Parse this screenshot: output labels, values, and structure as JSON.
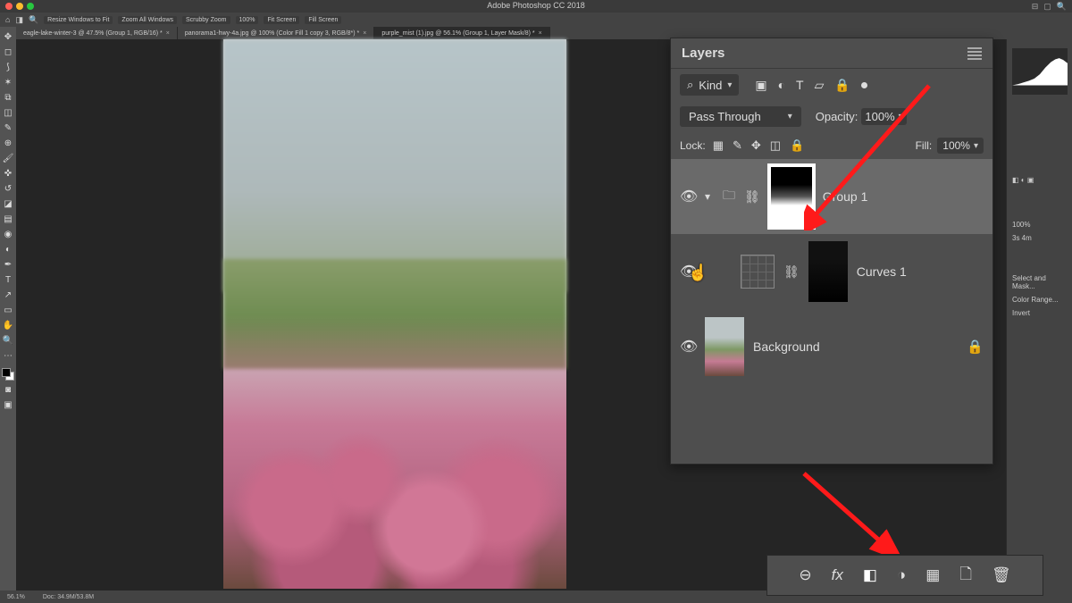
{
  "app_title": "Adobe Photoshop CC 2018",
  "window_controls": [
    "⊟",
    "▢",
    "✕"
  ],
  "options_bar": {
    "icons": [
      "⌂",
      "◨",
      "🔍"
    ],
    "buttons": [
      "Resize Windows to Fit",
      "Zoom All Windows",
      "Scrubby Zoom",
      "100%",
      "Fit Screen",
      "Fill Screen"
    ]
  },
  "doc_tabs": [
    {
      "label": "eagle-lake-winter-3 @ 47.5% (Group 1, RGB/16) *"
    },
    {
      "label": "panorama1-hwy-4a.jpg @ 100% (Color Fill 1 copy 3, RGB/8*) *"
    },
    {
      "label": "purple_mist (1).jpg @ 56.1% (Group 1, Layer Mask/8) *",
      "active": true
    }
  ],
  "status_bar": {
    "zoom": "56.1%",
    "doc": "Doc: 34.9M/53.8M"
  },
  "layers_panel": {
    "title": "Layers",
    "filter_kind": "Kind",
    "filter_icons": [
      "▣",
      "◐",
      "T",
      "▱",
      "🔒"
    ],
    "blend_mode": "Pass Through",
    "opacity_label": "Opacity:",
    "opacity_value": "100%",
    "lock_label": "Lock:",
    "lock_icons": [
      "▦",
      "✎",
      "✥",
      "◫",
      "🔒"
    ],
    "fill_label": "Fill:",
    "fill_value": "100%",
    "layers": [
      {
        "name": "Group 1",
        "type": "group",
        "selected": true
      },
      {
        "name": "Curves 1",
        "type": "adjustment"
      },
      {
        "name": "Background",
        "type": "image",
        "locked": true
      }
    ],
    "bottom_buttons": [
      "⊖",
      "fx",
      "◧",
      "◑",
      "▦",
      "🗋",
      "🗑"
    ]
  },
  "right_panel": {
    "items": [
      "100%",
      "3s 4m",
      "Select and Mask...",
      "Color Range...",
      "Invert"
    ]
  }
}
